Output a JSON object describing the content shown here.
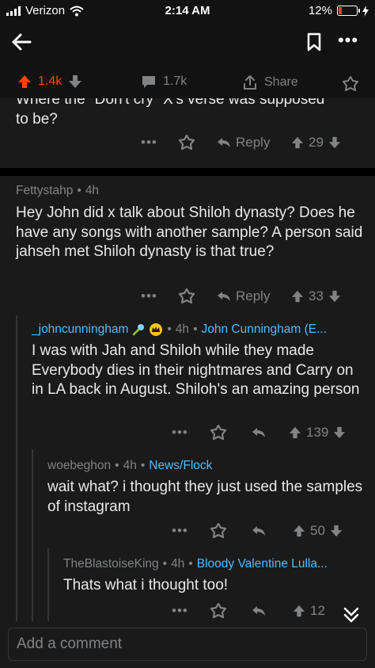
{
  "status_bar": {
    "carrier": "Verizon",
    "time": "2:14 AM",
    "battery": "12%"
  },
  "post_actions": {
    "upvotes": "1.4k",
    "comments": "1.7k",
    "share": "Share"
  },
  "top_comment": {
    "text_line1": "Where the \"Don't cry\" X's verse was supposed",
    "text_line2": "to be?",
    "reply_label": "Reply",
    "score": "29"
  },
  "comments": [
    {
      "author": "Fettystahp",
      "age": "4h",
      "text": "Hey John did x talk about Shiloh dynasty? Does he have any songs with another sample? A person said jahseh met Shiloh dynasty is that true?",
      "reply_label": "Reply",
      "score": "33"
    },
    {
      "author": "_johncunningham",
      "age": "4h",
      "flair": "John Cunningham (E...",
      "text": "I was with Jah and Shiloh while they made Everybody dies in their nightmares and Carry on in LA back in August. Shiloh's an amazing person",
      "score": "139"
    },
    {
      "author": "woebeghon",
      "age": "4h",
      "flair": "News/Flock",
      "text": "wait what? i thought they just used the samples of instagram",
      "score": "50"
    },
    {
      "author": "TheBlastoiseKing",
      "age": "4h",
      "flair": "Bloody Valentine Lulla...",
      "text": "Thats what i thought too!",
      "score": "12"
    }
  ],
  "footer": {
    "placeholder": "Add a comment"
  },
  "colors": {
    "accent_orange": "#ff4500",
    "link_blue": "#4fbcff",
    "battery_red": "#ff3b30"
  }
}
